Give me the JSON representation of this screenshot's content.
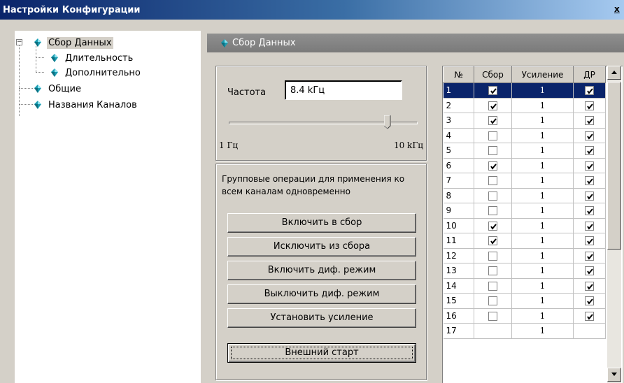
{
  "window": {
    "title": "Настройки Конфигурации",
    "close_glyph": "x"
  },
  "tree": {
    "expander": "−",
    "nodes": [
      {
        "label": "Сбор Данных",
        "icon": "gem-icon",
        "level": 0,
        "selected": true
      },
      {
        "label": "Длительность",
        "icon": "gem-icon",
        "level": 1
      },
      {
        "label": "Дополнительно",
        "icon": "gem-icon",
        "level": 1
      },
      {
        "label": "Общие",
        "icon": "gem-icon",
        "level": 0
      },
      {
        "label": "Названия Каналов",
        "icon": "gem-icon",
        "level": 0
      }
    ]
  },
  "panel": {
    "title": "Сбор Данных"
  },
  "frequency": {
    "label": "Частота",
    "value": "8.4 kГц",
    "slider_min": "1 Гц",
    "slider_max": "10 kГц",
    "slider_position": 0.84
  },
  "group_ops": {
    "description": "Групповые операции для применения ко всем каналам одновременно",
    "buttons": [
      "Включить в сбор",
      "Исключить из сбора",
      "Включить диф. режим",
      "Выключить диф. режим",
      "Установить усиление"
    ],
    "external_start": "Внешний старт"
  },
  "channels": {
    "headers": [
      "№",
      "Сбор",
      "Усиление",
      "ДР"
    ],
    "selected_row": 1,
    "rows": [
      {
        "n": "1",
        "sbor": true,
        "gain": "1",
        "dr": true
      },
      {
        "n": "2",
        "sbor": true,
        "gain": "1",
        "dr": true
      },
      {
        "n": "3",
        "sbor": true,
        "gain": "1",
        "dr": true
      },
      {
        "n": "4",
        "sbor": false,
        "gain": "1",
        "dr": true
      },
      {
        "n": "5",
        "sbor": false,
        "gain": "1",
        "dr": true
      },
      {
        "n": "6",
        "sbor": true,
        "gain": "1",
        "dr": true
      },
      {
        "n": "7",
        "sbor": false,
        "gain": "1",
        "dr": true
      },
      {
        "n": "8",
        "sbor": false,
        "gain": "1",
        "dr": true
      },
      {
        "n": "9",
        "sbor": false,
        "gain": "1",
        "dr": true
      },
      {
        "n": "10",
        "sbor": true,
        "gain": "1",
        "dr": true
      },
      {
        "n": "11",
        "sbor": true,
        "gain": "1",
        "dr": true
      },
      {
        "n": "12",
        "sbor": false,
        "gain": "1",
        "dr": true
      },
      {
        "n": "13",
        "sbor": false,
        "gain": "1",
        "dr": true
      },
      {
        "n": "14",
        "sbor": false,
        "gain": "1",
        "dr": true
      },
      {
        "n": "15",
        "sbor": false,
        "gain": "1",
        "dr": true
      },
      {
        "n": "16",
        "sbor": false,
        "gain": "1",
        "dr": true
      },
      {
        "n": "17",
        "sbor": null,
        "gain": "1",
        "dr": null
      }
    ]
  },
  "colors": {
    "accent": "#0a246a",
    "gem": "#1a9bb0"
  }
}
